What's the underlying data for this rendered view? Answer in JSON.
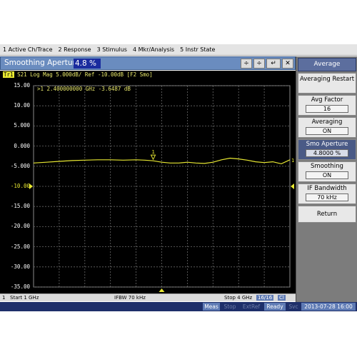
{
  "menu": [
    "1 Active Ch/Trace",
    "2 Response",
    "3 Stimulus",
    "4 Mkr/Analysis",
    "5 Instr State"
  ],
  "entry": {
    "label": "Smoothing Aperture",
    "value": "4.8 %",
    "step_label": "÷",
    "enter_label": "↵",
    "close_label": "✕"
  },
  "trace": {
    "badge": "Tr1",
    "header": "S21 Log Mag 5.000dB/ Ref -10.00dB [F2 Smo]",
    "marker_readout": ">1  2.400000000 GHz -3.6487 dB",
    "marker_label": "1",
    "end_marker_label": "1",
    "color": "#e8e832"
  },
  "chart_data": {
    "type": "line",
    "ylabel_ticks": [
      "15.00",
      "10.00",
      "5.000",
      "0.000",
      "-5.000",
      "-10.00",
      "-15.00",
      "-20.00",
      "-25.00",
      "-30.00",
      "-35.00"
    ],
    "y_range": [
      -35,
      15
    ],
    "x_range_ghz": [
      1,
      4
    ],
    "ref_level": -10,
    "scale_per_div": 5,
    "grid": true,
    "series": [
      {
        "x": [
          1.0,
          1.15,
          1.3,
          1.45,
          1.6,
          1.75,
          1.9,
          2.05,
          2.2,
          2.3,
          2.4,
          2.5,
          2.6,
          2.7,
          2.8,
          2.9,
          3.0,
          3.1,
          3.2,
          3.3,
          3.4,
          3.5,
          3.6,
          3.7,
          3.8,
          3.9,
          4.0
        ],
        "y": [
          -4.2,
          -4.0,
          -3.8,
          -3.6,
          -3.5,
          -3.4,
          -3.4,
          -3.5,
          -3.4,
          -3.5,
          -3.65,
          -4.0,
          -4.2,
          -4.2,
          -4.0,
          -4.2,
          -4.3,
          -4.0,
          -3.4,
          -3.0,
          -3.2,
          -3.5,
          -3.9,
          -4.1,
          -3.9,
          -4.4,
          -3.4
        ]
      }
    ]
  },
  "status_line": {
    "channel": "1",
    "start": "Start 1 GHz",
    "ifbw": "IFBW 70 kHz",
    "stop": "Stop 4 GHz",
    "points": "16/16",
    "cl": "Cl"
  },
  "bottom_bar": {
    "meas": "Meas",
    "stop": "Stop",
    "extref": "ExtRef",
    "ready": "Ready",
    "svc": "Svc",
    "datetime": "2013-07-28 16:00"
  },
  "softkeys": {
    "title": "Average",
    "items": [
      {
        "label": "Averaging Restart",
        "value": ""
      },
      {
        "label": "Avg Factor",
        "value": "16"
      },
      {
        "label": "Averaging",
        "value": "ON"
      },
      {
        "label": "Smo Aperture",
        "value": "4.8000 %"
      },
      {
        "label": "Smoothing",
        "value": "ON"
      },
      {
        "label": "IF Bandwidth",
        "value": "70 kHz"
      },
      {
        "label": "Return",
        "value": ""
      }
    ]
  }
}
